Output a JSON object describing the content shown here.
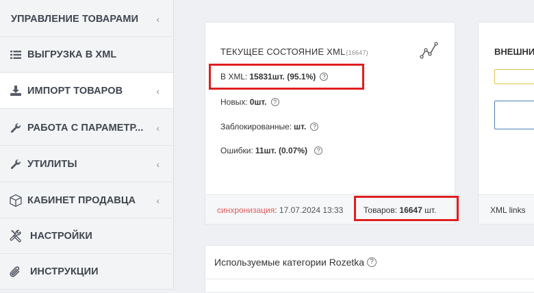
{
  "sidebar": {
    "items": [
      {
        "label": "УПРАВЛЕНИЕ ТОВАРАМИ",
        "icon": "none",
        "chevron": true
      },
      {
        "label": "ВЫГРУЗКА В XML",
        "icon": "list-icon",
        "chevron": false
      },
      {
        "label": "ИМПОРТ ТОВАРОВ",
        "icon": "download-icon",
        "chevron": true
      },
      {
        "label": "РАБОТА С ПАРАМЕТР...",
        "icon": "wrench-icon",
        "chevron": true
      },
      {
        "label": "УТИЛИТЫ",
        "icon": "wrench-icon",
        "chevron": true
      },
      {
        "label": "КАБИНЕТ ПРОДАВЦА",
        "icon": "cube-icon",
        "chevron": true
      },
      {
        "label": "НАСТРОЙКИ",
        "icon": "tools-icon",
        "chevron": false
      },
      {
        "label": "ИНСТРУКЦИИ",
        "icon": "paperclip-icon",
        "chevron": false
      }
    ],
    "chevron_glyph": "‹"
  },
  "xml_status": {
    "title": "ТЕКУЩЕЕ СОСТОЯНИЕ XML",
    "title_count": "(16647)",
    "in_xml_label": "В XML:",
    "in_xml_value": "15831шт. (95.1%)",
    "new_label": "Новых:",
    "new_value": "0шт.",
    "blocked_label": "Заблокированные:",
    "blocked_value": "шт.",
    "errors_label": "Ошибки:",
    "errors_value": "11шт. (0.07%)",
    "sync_link": "синхронизация",
    "sync_value": ": 17.07.2024 13:33",
    "total_label": "Товаров:",
    "total_value": "16647",
    "total_unit": "шт.",
    "help_glyph": "?"
  },
  "external": {
    "title": "ВНЕШНИ",
    "footer": "XML links"
  },
  "categories": {
    "title": "Используемые категории Rozetka"
  },
  "colors": {
    "highlight": "#e01e1e",
    "sync_link": "#e05a5a",
    "input_yellow": "#e0c24a",
    "input_blue": "#4a7fb8"
  }
}
